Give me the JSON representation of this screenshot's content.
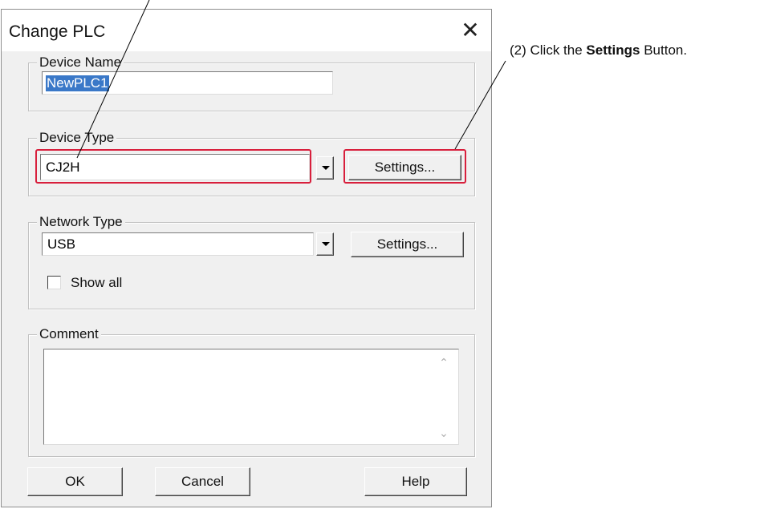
{
  "dialog": {
    "title": "Change PLC",
    "close_symbol": "✕"
  },
  "device_name": {
    "group_label": "Device Name",
    "value": "NewPLC1"
  },
  "device_type": {
    "group_label": "Device Type",
    "value": "CJ2H",
    "settings_label": "Settings..."
  },
  "network_type": {
    "group_label": "Network Type",
    "value": "USB",
    "settings_label": "Settings...",
    "show_all_label": "Show all",
    "show_all_checked": false
  },
  "comment": {
    "group_label": "Comment",
    "value": ""
  },
  "buttons": {
    "ok": "OK",
    "cancel": "Cancel",
    "help": "Help"
  },
  "annotation": {
    "prefix": "(2) Click the ",
    "bold": "Settings",
    "suffix": " Button."
  },
  "colors": {
    "highlight": "#d81f3c",
    "selection": "#3a78c8",
    "dialog_bg": "#f0f0f0"
  },
  "icons": {
    "close": "close-icon",
    "dropdown": "chevron-down-icon",
    "scroll_up": "scroll-up-icon",
    "scroll_down": "scroll-down-icon"
  }
}
